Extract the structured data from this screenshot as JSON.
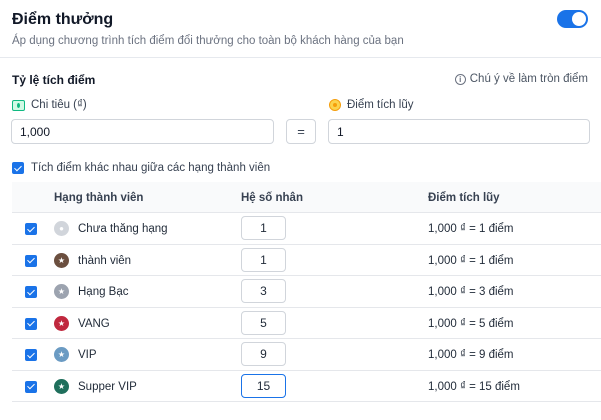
{
  "header": {
    "title": "Điểm thưởng",
    "subtitle": "Áp dụng chương trình tích điểm đổi thưởng cho toàn bộ khách hàng của bạn",
    "enabled": true
  },
  "rate": {
    "section_title": "Tỷ lệ tích điểm",
    "note": "Chú ý về làm tròn điểm",
    "spend_label": "Chi tiêu (₫)",
    "spend_value": "1,000",
    "equals": "=",
    "points_label": "Điểm tích lũy",
    "points_value": "1"
  },
  "tier_option": {
    "label": "Tích điểm khác nhau giữa các hạng thành viên",
    "checked": true
  },
  "table": {
    "headers": [
      "Hạng thành viên",
      "Hệ số nhân",
      "Điểm tích lũy"
    ],
    "rows": [
      {
        "name": "Chưa thăng hạng",
        "multiplier": "1",
        "points": "1,000 ₫ = 1 điểm",
        "badge_color": "#d1d5db",
        "icon": "user-icon"
      },
      {
        "name": "thành viên",
        "multiplier": "1",
        "points": "1,000 ₫ = 1 điểm",
        "badge_color": "#6b4f3f",
        "icon": "star-icon"
      },
      {
        "name": "Hạng Bạc",
        "multiplier": "3",
        "points": "1,000 ₫ = 3 điểm",
        "badge_color": "#9ca3af",
        "icon": "star-icon"
      },
      {
        "name": "VANG",
        "multiplier": "5",
        "points": "1,000 ₫ = 5 điểm",
        "badge_color": "#c0283e",
        "icon": "star-icon"
      },
      {
        "name": "VIP",
        "multiplier": "9",
        "points": "1,000 ₫ = 9 điểm",
        "badge_color": "#6b9bc3",
        "icon": "star-icon"
      },
      {
        "name": "Supper VIP",
        "multiplier": "15",
        "points": "1,000 ₫ = 15 điểm",
        "badge_color": "#1f6f5c",
        "icon": "star-icon"
      }
    ]
  },
  "colors": {
    "accent": "#1a73e8"
  }
}
